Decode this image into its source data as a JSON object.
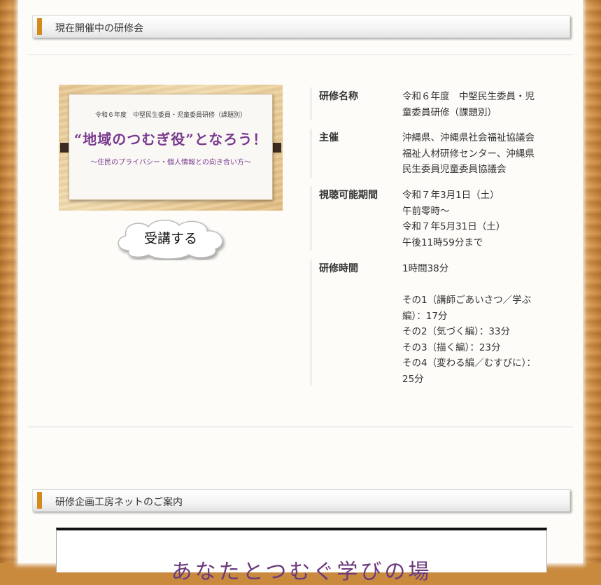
{
  "section1": {
    "title": "現在開催中の研修会"
  },
  "banner": {
    "small_text": "令和６年度　中堅民生委員・児童委員研修（課題別）",
    "big_text": "“地域のつむぎ役”となろう！",
    "sub_text": "〜住民のプライバシー・個人情報との向き合い方〜"
  },
  "enroll_button": {
    "label": "受講する"
  },
  "info": {
    "name": {
      "label": "研修名称",
      "lines": [
        "令和６年度　中堅民生委員・児",
        "童委員研修（課題別）"
      ]
    },
    "host": {
      "label": "主催",
      "lines": [
        "沖縄県、沖縄県社会福祉協議会",
        "福祉人材研修センター、沖縄県",
        "民生委員児童委員協議会"
      ]
    },
    "period": {
      "label": "視聴可能期間",
      "lines": [
        "令和７年3月1日（土）",
        "午前零時〜",
        "令和７年5月31日（土）",
        "午後11時59分まで"
      ]
    },
    "duration": {
      "label": "研修時間",
      "lines": [
        "1時間38分",
        "",
        "その1（講師ごあいさつ／学ぶ",
        "編）：17分",
        "その2（気づく編）：33分",
        "その3（描く編）：23分",
        "その4（変わる編／むすびに）：",
        "25分"
      ]
    }
  },
  "section2": {
    "title": "研修企画工房ネットのご案内"
  },
  "bottom_banner": {
    "text": "あなたとつむぐ学びの場"
  },
  "colors": {
    "accent": "#d38b1c",
    "purple": "#7a3a8e",
    "wood": "#c98a3e"
  }
}
